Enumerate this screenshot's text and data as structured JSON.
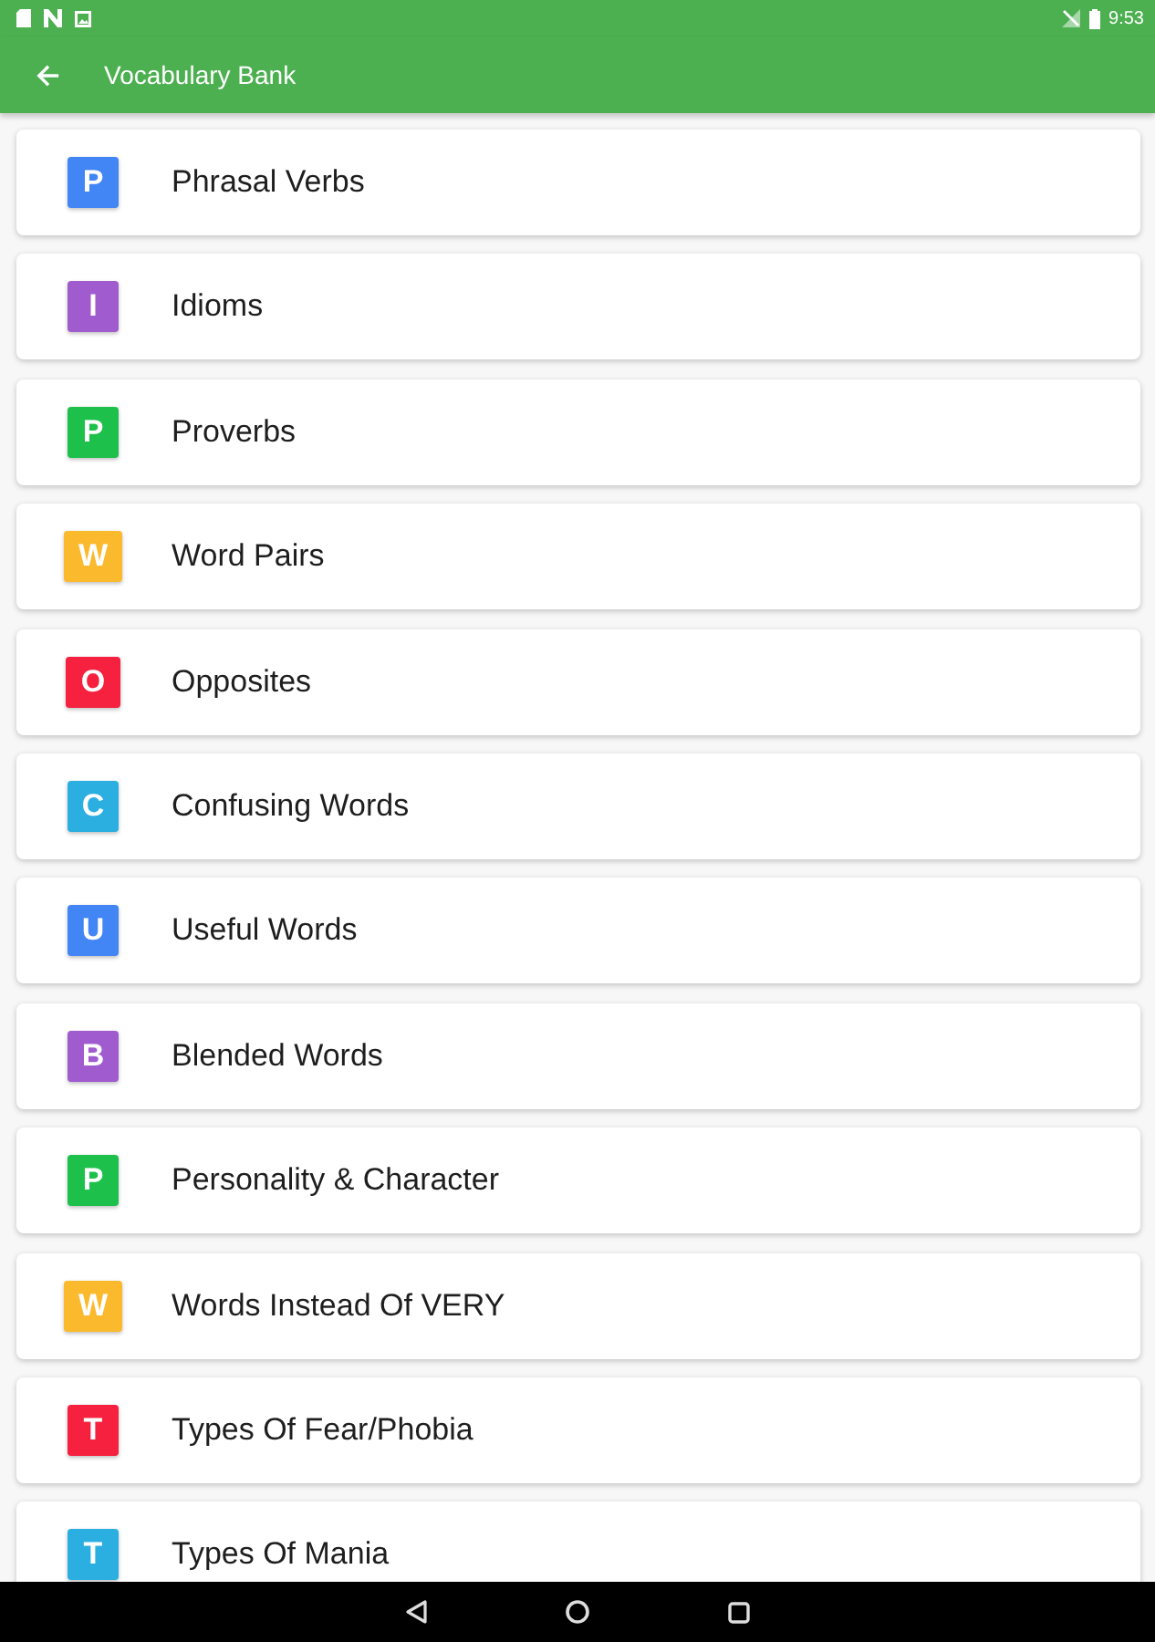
{
  "status_bar": {
    "time": "9:53"
  },
  "app_bar": {
    "title": "Vocabulary Bank"
  },
  "categories": [
    {
      "letter": "P",
      "label": "Phrasal Verbs",
      "color": "#4285f4"
    },
    {
      "letter": "I",
      "label": "Idioms",
      "color": "#a05ccf"
    },
    {
      "letter": "P",
      "label": "Proverbs",
      "color": "#1ec04c"
    },
    {
      "letter": "W",
      "label": "Word Pairs",
      "color": "#fbb92d"
    },
    {
      "letter": "O",
      "label": "Opposites",
      "color": "#f5213f"
    },
    {
      "letter": "C",
      "label": "Confusing Words",
      "color": "#2baee0"
    },
    {
      "letter": "U",
      "label": "Useful Words",
      "color": "#4285f4"
    },
    {
      "letter": "B",
      "label": "Blended Words",
      "color": "#a05ccf"
    },
    {
      "letter": "P",
      "label": "Personality & Character",
      "color": "#1ec04c"
    },
    {
      "letter": "W",
      "label": "Words Instead Of VERY",
      "color": "#fbb92d"
    },
    {
      "letter": "T",
      "label": "Types Of Fear/Phobia",
      "color": "#f5213f"
    },
    {
      "letter": "T",
      "label": "Types Of Mania",
      "color": "#2baee0"
    }
  ]
}
